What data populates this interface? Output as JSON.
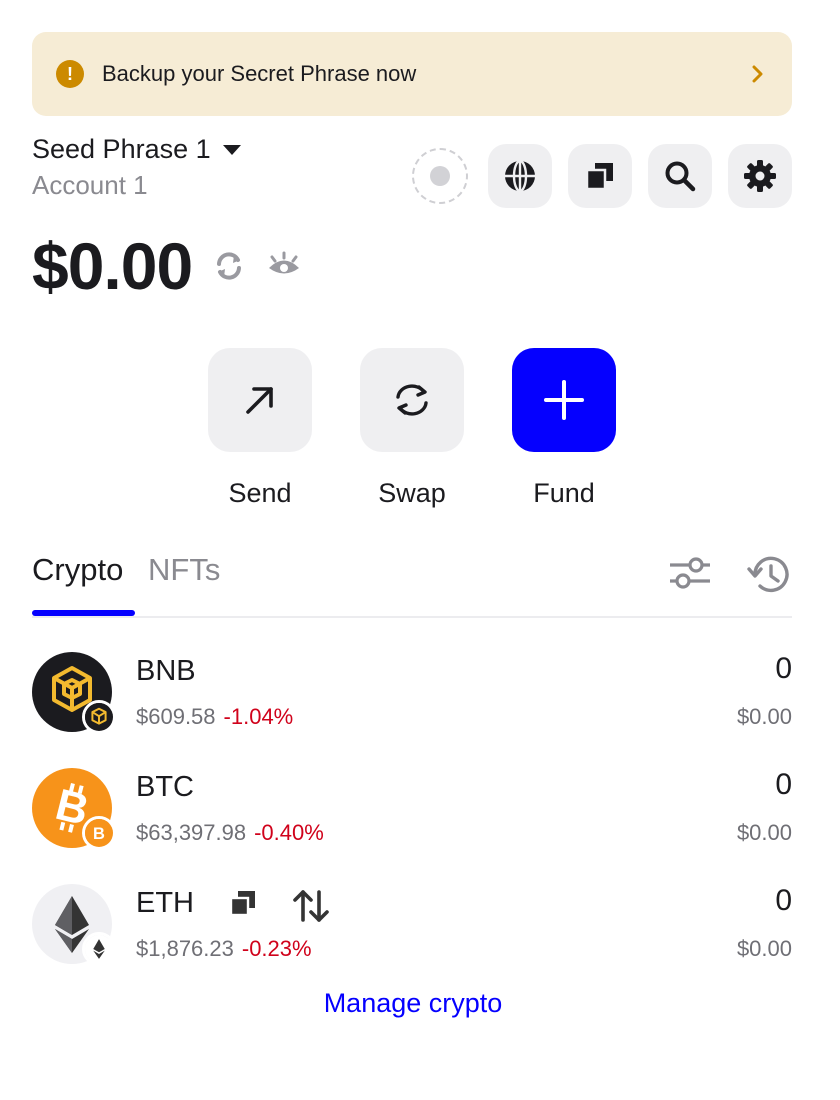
{
  "banner": {
    "text": "Backup your Secret Phrase now",
    "warning_glyph": "!",
    "accent": "#cc8a00",
    "background": "#f6ecd5"
  },
  "header": {
    "wallet_name": "Seed Phrase 1",
    "account_name": "Account 1",
    "icons": [
      "connection-status-icon",
      "globe-icon",
      "copy-icon",
      "search-icon",
      "settings-gear-icon"
    ]
  },
  "balance": {
    "total": "$0.00"
  },
  "actions": [
    {
      "label": "Send",
      "icon": "arrow-up-right-icon"
    },
    {
      "label": "Swap",
      "icon": "swap-arrows-icon"
    },
    {
      "label": "Fund",
      "icon": "plus-icon"
    }
  ],
  "tabs": [
    {
      "label": "Crypto",
      "active": true
    },
    {
      "label": "NFTs",
      "active": false
    }
  ],
  "assets": [
    {
      "symbol": "BNB",
      "price": "$609.58",
      "change": "-1.04%",
      "amount": "0",
      "value": "$0.00",
      "color": "#f3ba2f"
    },
    {
      "symbol": "BTC",
      "price": "$63,397.98",
      "change": "-0.40%",
      "amount": "0",
      "value": "$0.00",
      "color": "#f7931a"
    },
    {
      "symbol": "ETH",
      "price": "$1,876.23",
      "change": "-0.23%",
      "amount": "0",
      "value": "$0.00",
      "color": "#343434"
    }
  ],
  "manage_link": "Manage crypto",
  "colors": {
    "brand_blue": "#0500ff",
    "negative": "#d0021b"
  }
}
